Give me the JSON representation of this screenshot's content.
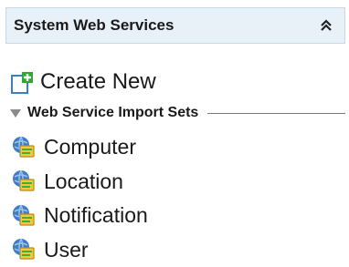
{
  "panel": {
    "title": "System Web Services",
    "collapse_icon": "double-chevron-up-icon"
  },
  "create": {
    "label": "Create New",
    "icon": "new-document-plus-icon"
  },
  "section": {
    "label": "Web Service Import Sets",
    "expand_icon": "triangle-down-icon"
  },
  "items": [
    {
      "label": "Computer",
      "icon": "web-service-icon"
    },
    {
      "label": "Location",
      "icon": "web-service-icon"
    },
    {
      "label": "Notification",
      "icon": "web-service-icon"
    },
    {
      "label": "User",
      "icon": "web-service-icon"
    }
  ],
  "colors": {
    "header_bg": "#e8f0f8",
    "header_border": "#c9d8e8",
    "plus_green": "#2fa82f",
    "globe_blue": "#3f7ec2",
    "folder_yellow": "#f2c744"
  }
}
